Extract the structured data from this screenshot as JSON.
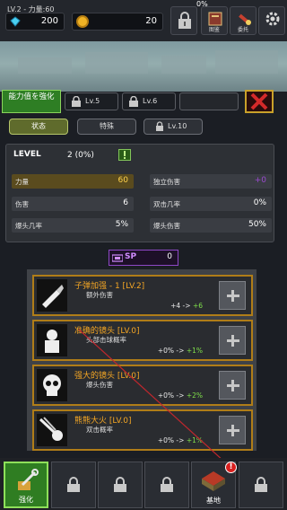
{
  "hud": {
    "level_text": "LV.2 - 力量:60",
    "xp_percent": "0%",
    "gems": "200",
    "coins": "20",
    "atlas_label": "图鉴",
    "commission_label": "委托"
  },
  "tabs": {
    "main": "能力值を強化",
    "locked": [
      "Lv.5",
      "Lv.6"
    ]
  },
  "subtabs": {
    "status": "状态",
    "special": "特殊",
    "locked": "Lv.10"
  },
  "stats": {
    "level_label": "LEVEL",
    "level_value": "2 (0%)",
    "left": [
      {
        "label": "力量",
        "value": "60"
      },
      {
        "label": "伤害",
        "value": "6"
      },
      {
        "label": "爆头几率",
        "value": "5%"
      }
    ],
    "right": [
      {
        "label": "独立伤害",
        "value": "+0"
      },
      {
        "label": "双击几率",
        "value": "0%"
      },
      {
        "label": "爆头伤害",
        "value": "50%"
      }
    ]
  },
  "sp": {
    "label": "SP",
    "value": "0"
  },
  "skills": [
    {
      "name": "子弹加强 - 1 [LV.2]",
      "desc": "额外伤害",
      "from": "+4",
      "to": "+6"
    },
    {
      "name": "准确的镜头 [LV.0]",
      "desc": "头部击球概率",
      "from": "+0%",
      "to": "+1%"
    },
    {
      "name": "强大的镜头 [LV.0]",
      "desc": "爆头伤害",
      "from": "+0%",
      "to": "+2%"
    },
    {
      "name": "熊熊大火 [LV.0]",
      "desc": "双击概率",
      "from": "+0%",
      "to": "+1%"
    }
  ],
  "bottom_nav": {
    "strengthen": "强化",
    "base": "基地",
    "base_badge": "!"
  },
  "colors": {
    "accent_green": "#2f7d22",
    "skill_title": "#f4a624",
    "gold_value": "#ffd24a",
    "sp_purple": "#8e48c6"
  }
}
